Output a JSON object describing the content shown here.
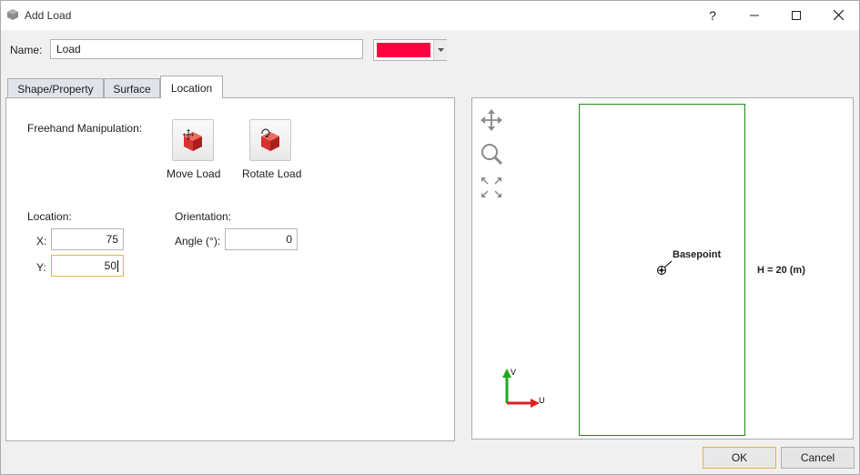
{
  "window": {
    "title": "Add Load",
    "controls": {
      "help": "?",
      "minimize": "minimize-icon",
      "maximize": "maximize-icon",
      "close": "close-icon"
    }
  },
  "name_row": {
    "label": "Name:",
    "value": "Load",
    "color": "#ff0040"
  },
  "tabs": [
    {
      "label": "Shape/Property",
      "active": false
    },
    {
      "label": "Surface",
      "active": false
    },
    {
      "label": "Location",
      "active": true
    }
  ],
  "location_tab": {
    "freehand_label": "Freehand Manipulation:",
    "move_button_label": "Move Load",
    "rotate_button_label": "Rotate Load",
    "location_label": "Location:",
    "x_label": "X:",
    "x_value": "75",
    "y_label": "Y:",
    "y_value": "50",
    "orientation_label": "Orientation:",
    "angle_label": "Angle (°):",
    "angle_value": "0"
  },
  "viewport": {
    "tools": [
      "pan-icon",
      "zoom-icon",
      "fit-to-view-icon"
    ],
    "basepoint_label": "Basepoint",
    "height_label": "H = 20 (m)",
    "axis_v_label": "V",
    "axis_u_label": "U",
    "region_color": "#1d8a1d"
  },
  "footer": {
    "ok_label": "OK",
    "cancel_label": "Cancel"
  }
}
